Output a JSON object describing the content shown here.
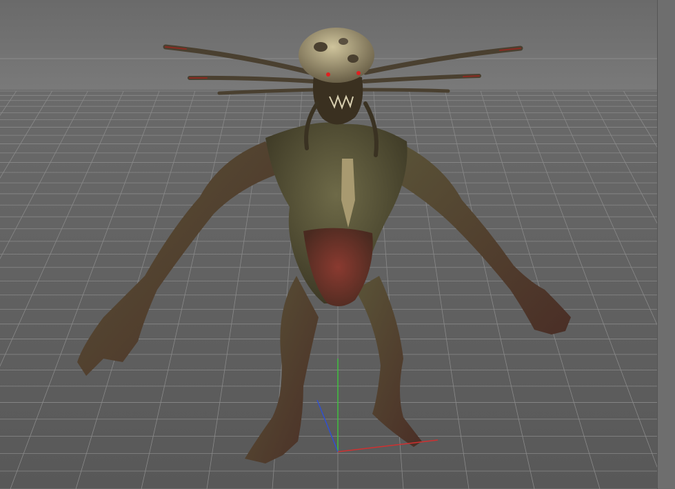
{
  "viewport": {
    "sky_color": "#707070",
    "ground_color": "#5d5d5d",
    "grid_color": "#8a8a8a",
    "axis_colors": {
      "x": "#d03030",
      "y": "#40c040",
      "z": "#3050d0"
    }
  },
  "model": {
    "skin_color": "#5e5a3e",
    "flesh_color": "#6a3a2e",
    "skull_color": "#b8ad88",
    "eye_color": "#e02020"
  }
}
